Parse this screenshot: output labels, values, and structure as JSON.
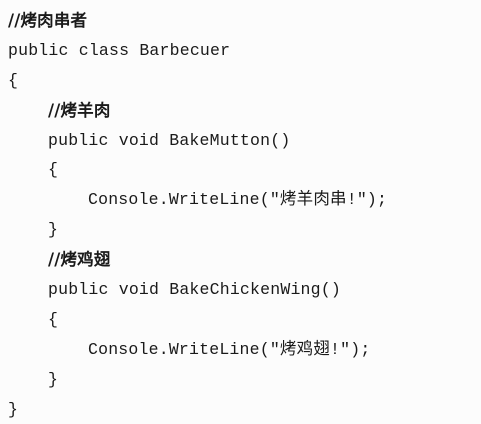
{
  "code": {
    "line_01": "//烤肉串者",
    "line_02": "public class Barbecuer",
    "line_03": "{",
    "line_04": "//烤羊肉",
    "line_05": "public void BakeMutton()",
    "line_06": "{",
    "line_07": "Console.WriteLine(\"烤羊肉串!\");",
    "line_08": "}",
    "line_09": "//烤鸡翅",
    "line_10": "public void BakeChickenWing()",
    "line_11": "{",
    "line_12": "Console.WriteLine(\"烤鸡翅!\");",
    "line_13": "}",
    "line_14": "}"
  }
}
